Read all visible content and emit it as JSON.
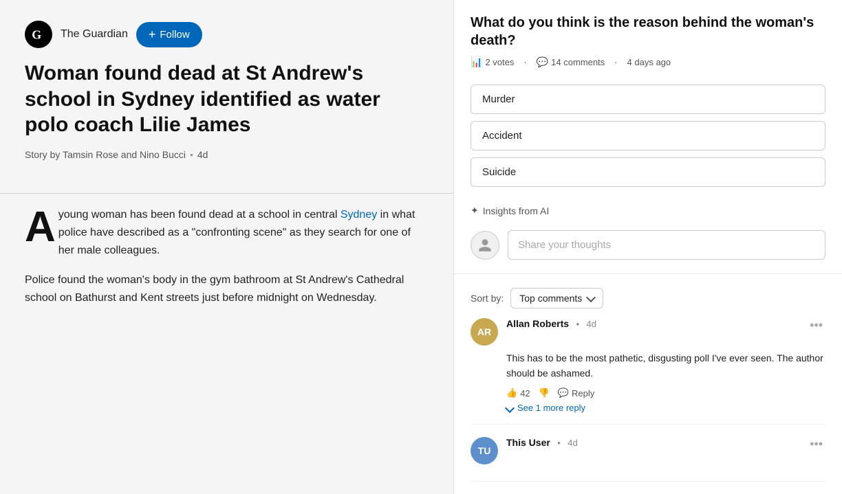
{
  "left": {
    "publisher": {
      "name": "The Guardian",
      "follow_label": "Follow"
    },
    "article": {
      "title": "Woman found dead at St Andrew's school in Sydney identified as water polo coach Lilie James",
      "meta_story": "Story by Tamsin Rose and Nino Bucci",
      "meta_time": "4d",
      "body_p1_drop": "A",
      "body_p1_rest": "young woman has been found dead at a school in central",
      "body_p1_link": "Sydney",
      "body_p1_end": " in what police have described as a \"confronting scene\" as they search for one of her male colleagues.",
      "body_p2": "Police found the woman's body in the gym bathroom at St Andrew's Cathedral school on Bathurst and Kent streets just before midnight on Wednesday."
    }
  },
  "right": {
    "poll": {
      "question": "What do you think is the reason behind the woman's death?",
      "votes": "2 votes",
      "comments": "14 comments",
      "time": "4 days ago",
      "options": [
        "Murder",
        "Accident",
        "Suicide"
      ]
    },
    "insights": {
      "label": "Insights from AI"
    },
    "share": {
      "placeholder": "Share your thoughts"
    },
    "sort": {
      "label": "Sort by:",
      "value": "Top comments"
    },
    "comments": [
      {
        "id": "ar",
        "initials": "AR",
        "author": "Allan Roberts",
        "time": "4d",
        "text": "This has to be the most pathetic, disgusting poll I've ever seen. The author should be ashamed.",
        "likes": "42",
        "reply_label": "Reply",
        "see_more": "See 1 more reply"
      },
      {
        "id": "tu",
        "initials": "TU",
        "author": "This User",
        "time": "4d",
        "text": "",
        "likes": "",
        "reply_label": "",
        "see_more": ""
      }
    ]
  }
}
